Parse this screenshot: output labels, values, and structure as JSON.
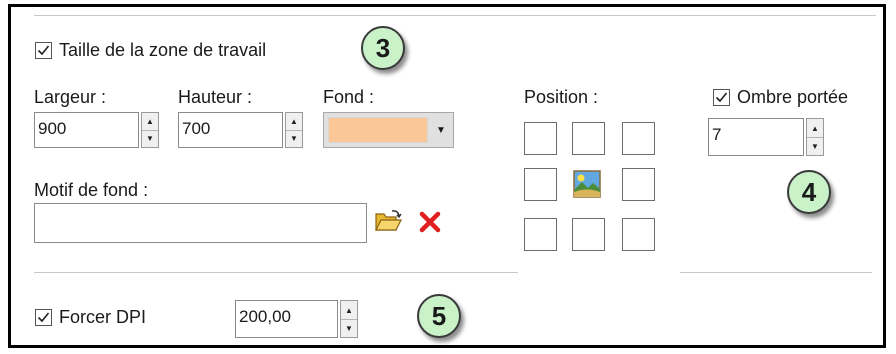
{
  "work_area": {
    "checkbox_label": "Taille de la zone de travail",
    "checked": true
  },
  "width": {
    "label": "Largeur :",
    "value": "900"
  },
  "height": {
    "label": "Hauteur :",
    "value": "700"
  },
  "background": {
    "label": "Fond :",
    "color": "#fcc797"
  },
  "pattern": {
    "label": "Motif de fond :",
    "value": ""
  },
  "position": {
    "label": "Position :",
    "selected": "center"
  },
  "shadow": {
    "checkbox_label": "Ombre portée",
    "checked": true,
    "value": "7"
  },
  "dpi": {
    "checkbox_label": "Forcer DPI",
    "checked": true,
    "value": "200,00"
  },
  "badges": [
    "3",
    "4",
    "5"
  ],
  "colors": {
    "delete_icon": "#e02020",
    "folder_icon": "#e8b830",
    "badge_fill": "#c9f2c8"
  }
}
